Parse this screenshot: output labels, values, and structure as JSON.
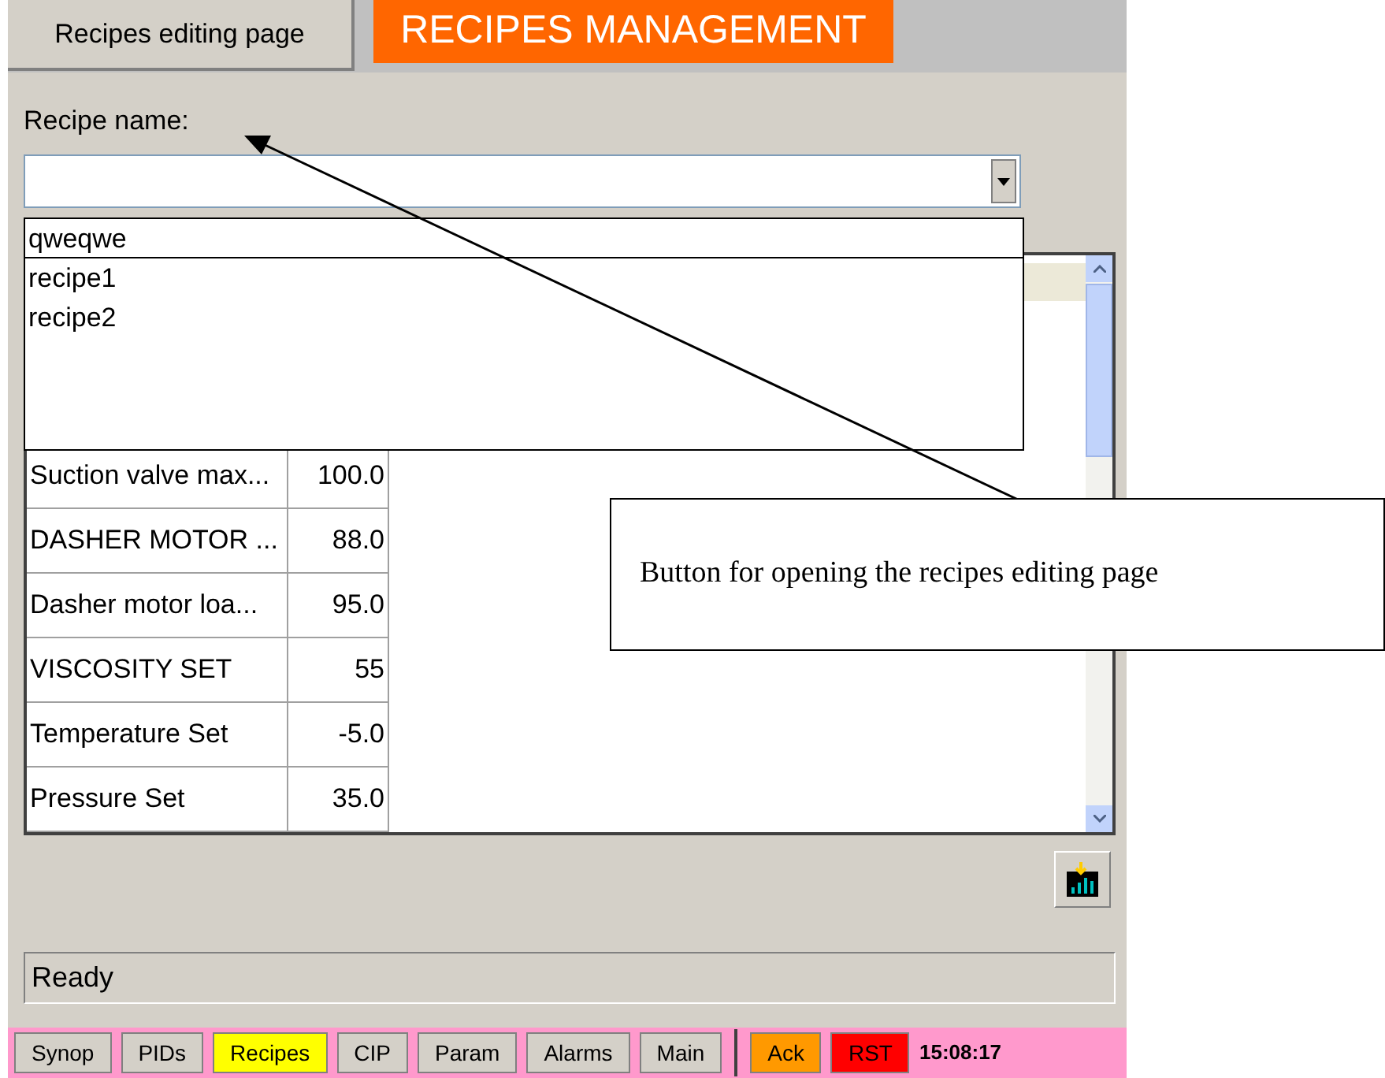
{
  "header": {
    "edit_button": "Recipes editing page",
    "title": "RECIPES MANAGEMENT"
  },
  "recipe_name": {
    "label": "Recipe name:"
  },
  "dropdown": {
    "expanded": true,
    "options": [
      {
        "label": "qweqwe",
        "selected": true
      },
      {
        "label": "recipe1",
        "selected": false
      },
      {
        "label": "recipe2",
        "selected": false
      }
    ]
  },
  "table": {
    "rows": [
      {
        "name": "Suction valve max...",
        "value": "100.0"
      },
      {
        "name": "DASHER MOTOR ...",
        "value": "88.0"
      },
      {
        "name": "Dasher motor loa...",
        "value": "95.0"
      },
      {
        "name": "VISCOSITY SET",
        "value": "55"
      },
      {
        "name": "Temperature Set",
        "value": "-5.0"
      },
      {
        "name": "Pressure Set",
        "value": "35.0"
      }
    ]
  },
  "status_bar": "Ready",
  "nav": {
    "buttons": [
      {
        "label": "Synop",
        "selected": false
      },
      {
        "label": "PIDs",
        "selected": false
      },
      {
        "label": "Recipes",
        "selected": true
      },
      {
        "label": "CIP",
        "selected": false
      },
      {
        "label": "Param",
        "selected": false
      },
      {
        "label": "Alarms",
        "selected": false
      },
      {
        "label": "Main",
        "selected": false
      }
    ],
    "alarm_buttons": [
      {
        "label": "Ack",
        "color": "#ff9900"
      },
      {
        "label": "RST",
        "color": "#ff0000"
      }
    ],
    "time": "15:08:17"
  },
  "annotation": {
    "text": "Button for opening the recipes editing page"
  }
}
